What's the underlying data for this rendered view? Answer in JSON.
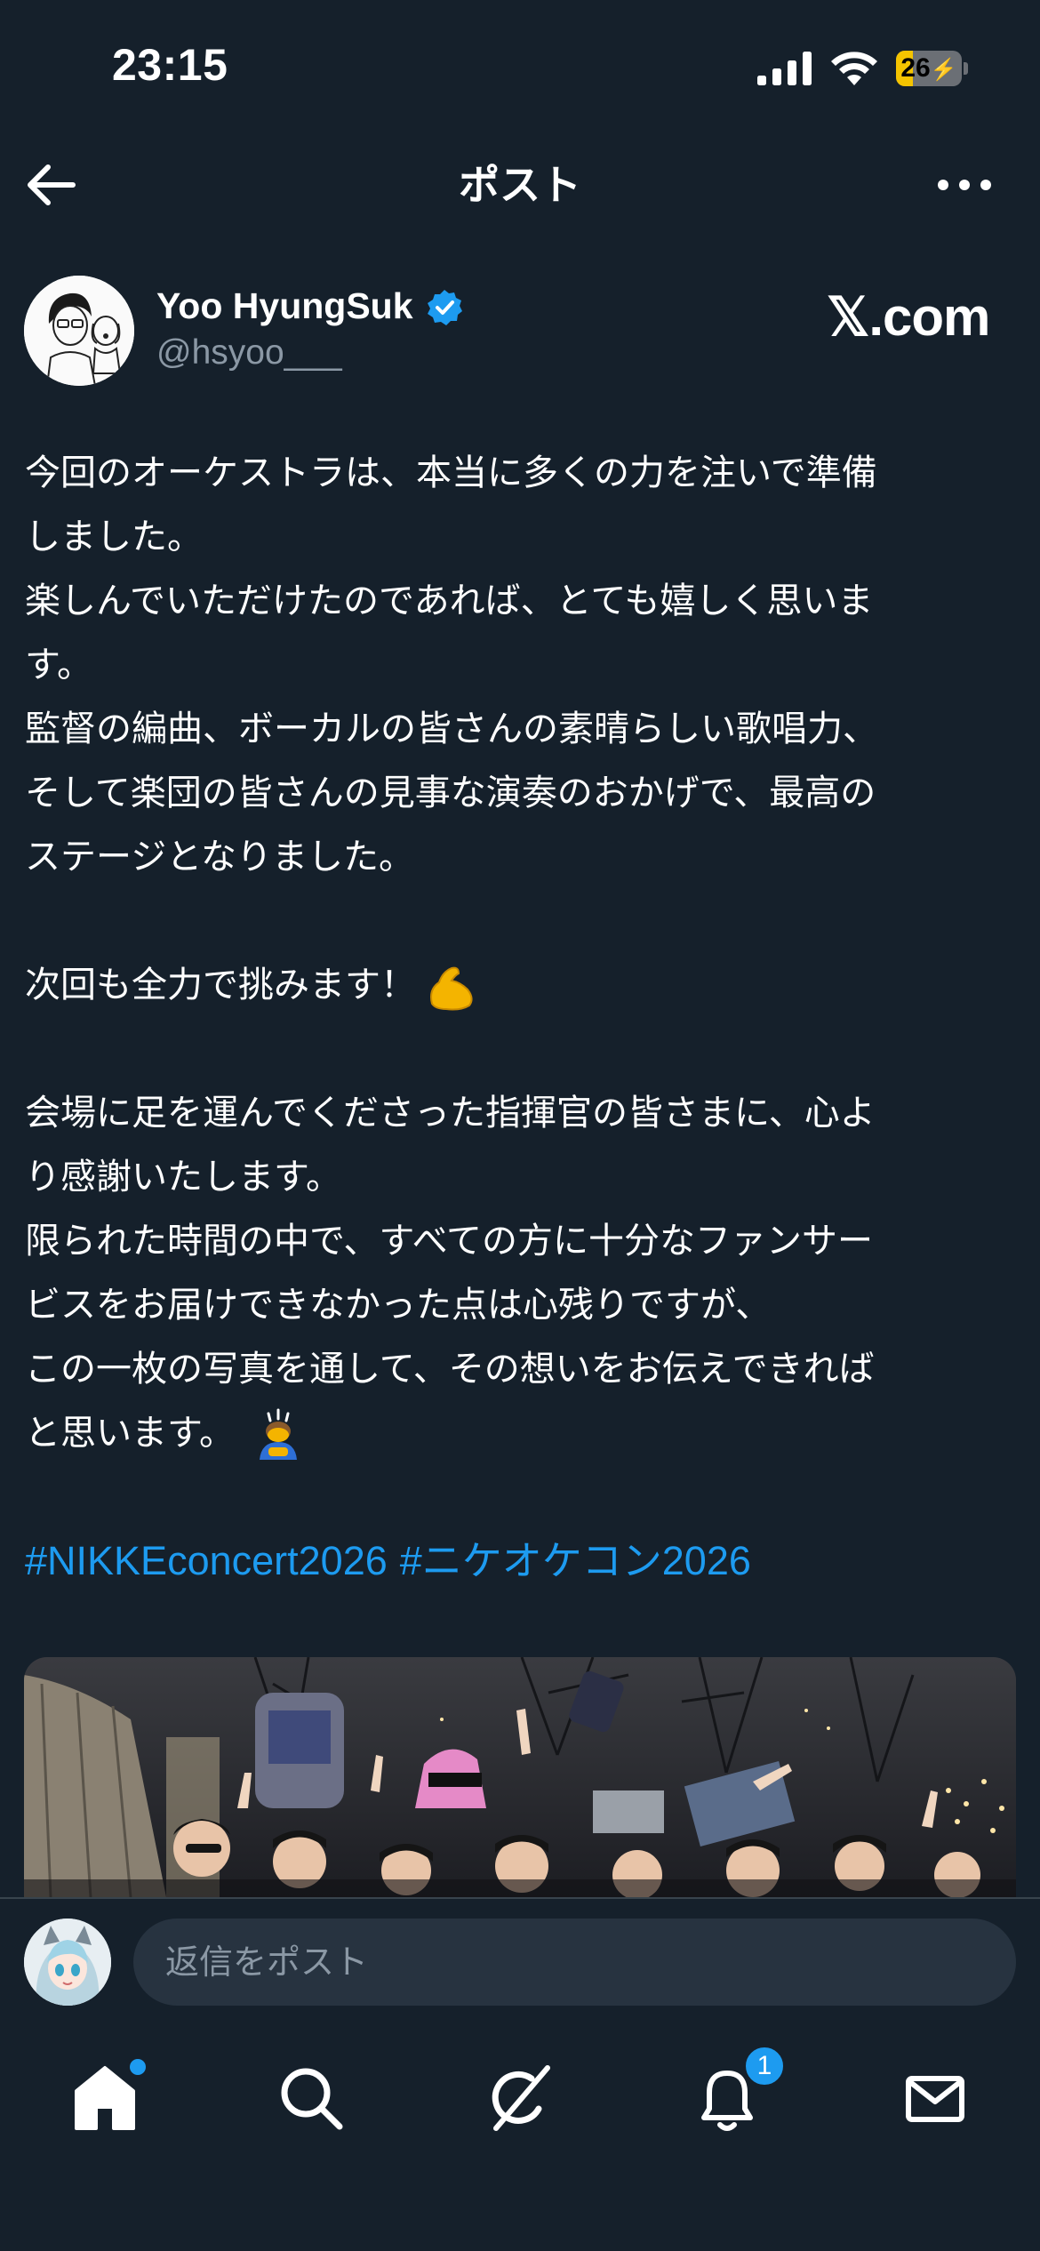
{
  "status_bar": {
    "time": "23:15",
    "battery_percent": "26",
    "battery_level": 0.26,
    "battery_color": "#f5c400"
  },
  "header": {
    "title": "ポスト",
    "back_icon": "arrow-left-icon",
    "more_icon": "more-horizontal-icon"
  },
  "post": {
    "author_name": "Yoo HyungSuk",
    "author_handle": "@hsyoo___",
    "verified": true,
    "watermark": "𝕏.com",
    "lines": [
      "今回のオーケストラは、本当に多くの力を注いで準備",
      "しました。",
      "楽しんでいただけたのであれば、とても嬉しく思いま",
      "す。",
      "監督の編曲、ボーカルの皆さんの素晴らしい歌唱力、",
      "そして楽団の皆さんの見事な演奏のおかげで、最高の",
      "ステージとなりました。",
      "",
      "次回も全力で挑みます！",
      "",
      "会場に足を運んでくださった指揮官の皆さまに、心よ",
      "り感謝いたします。",
      "限られた時間の中で、すべての方に十分なファンサー",
      "ビスをお届けできなかった点は心残りですが、",
      "この一枚の写真を通して、その想いをお伝えできれば",
      "と思います。",
      ""
    ],
    "emoji_line_8": "flexed-biceps-emoji",
    "emoji_line_15": "person-bowing-emoji",
    "hashtags": [
      "#NIKKEconcert2026",
      "#ニケオケコン2026"
    ],
    "link_color": "#1d9bf0"
  },
  "reply": {
    "placeholder": "返信をポスト"
  },
  "tab_bar": {
    "items": [
      {
        "icon": "home-icon",
        "active": true,
        "has_dot": true
      },
      {
        "icon": "search-icon"
      },
      {
        "icon": "grok-icon"
      },
      {
        "icon": "bell-icon",
        "badge": "1"
      },
      {
        "icon": "mail-icon"
      }
    ]
  }
}
